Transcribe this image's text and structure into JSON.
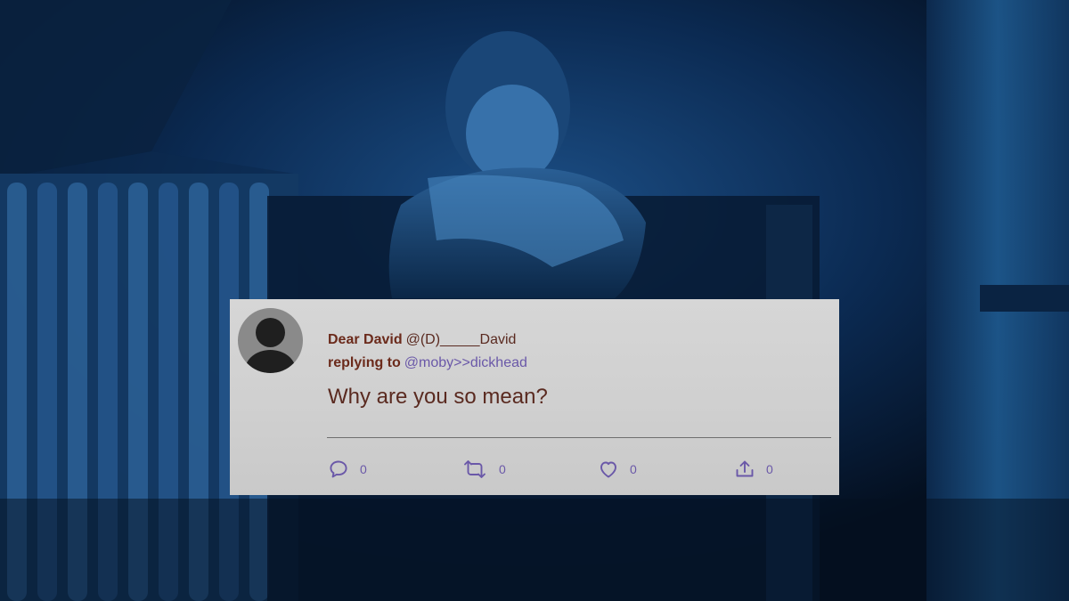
{
  "tweet": {
    "display_name": "Dear David",
    "handle": "@(D)_____David",
    "reply_prefix": "replying to",
    "reply_handle": "@moby>>dickhead",
    "text": "Why are you so mean?",
    "actions": {
      "reply": {
        "icon": "comment-bubble-icon",
        "count": "0"
      },
      "retweet": {
        "icon": "retweet-arrows-icon",
        "count": "0"
      },
      "like": {
        "icon": "heart-icon",
        "count": "0"
      },
      "share": {
        "icon": "share-upload-icon",
        "count": "0"
      }
    }
  },
  "colors": {
    "card_background": "#d3d3d3",
    "name_color": "#6b2a1b",
    "link_color": "#6a58a8",
    "icon_color": "#6a58a8",
    "scene_tint": "#0b2a55"
  }
}
